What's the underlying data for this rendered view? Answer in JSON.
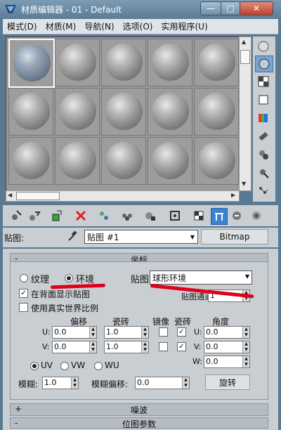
{
  "window": {
    "title": "材质编辑器 - 01 - Default",
    "minimize_icon": "minimize-icon",
    "maximize_icon": "maximize-icon",
    "close_icon": "close-icon"
  },
  "menu": [
    "模式(D)",
    "材质(M)",
    "导航(N)",
    "选项(O)",
    "实用程序(U)"
  ],
  "sample_slots": {
    "count": 15,
    "active_index": 0
  },
  "side_toolbar_icons": [
    "sample-type-icon",
    "backlight-icon",
    "background-icon",
    "uv-tiling-icon",
    "video-color-check-icon",
    "make-preview-icon",
    "options-icon",
    "select-by-material-icon",
    "material-map-navigator-icon"
  ],
  "bottom_toolbar_icons": [
    "get-material-icon",
    "put-to-scene-icon",
    "assign-to-selection-icon",
    "reset-map-icon",
    "make-unique-icon",
    "put-to-library-icon",
    "material-effects-channel-icon",
    "show-in-viewport-icon",
    "show-end-result-icon",
    "go-to-parent-icon",
    "go-forward-to-sibling-icon"
  ],
  "map_row": {
    "label": "贴图:",
    "map_name": "贴图 #1",
    "type_button": "Bitmap"
  },
  "rollouts": {
    "coordinates": {
      "sign": "-",
      "title": "坐标"
    },
    "noise": {
      "sign": "+",
      "title": "噪波"
    },
    "bitmap_params": {
      "sign": "-",
      "title": "位图参数"
    }
  },
  "coords": {
    "texture_label": "纹理",
    "environ_label": "环境",
    "mapping_label": "贴图:",
    "mapping_value": "球形环境",
    "show_map_on_back": "在背面显示贴图",
    "map_channel_label": "贴图通道:",
    "map_channel_value": "1",
    "real_world_scale": "使用真实世界比例",
    "headers": {
      "offset": "偏移",
      "tiling": "瓷砖",
      "mirror": "镜像",
      "tile": "瓷砖",
      "angle": "角度"
    },
    "u": {
      "label": "U:",
      "offset": "0.0",
      "tiling": "1.0",
      "angle_label": "U:",
      "angle": "0.0"
    },
    "v": {
      "label": "V:",
      "offset": "0.0",
      "tiling": "1.0",
      "angle_label": "V:",
      "angle": "0.0"
    },
    "w": {
      "angle_label": "W:",
      "angle": "0.0"
    },
    "uv": "UV",
    "vw": "VW",
    "wu": "WU",
    "blur_label": "模糊:",
    "blur_value": "1.0",
    "blur_offset_label": "模糊偏移:",
    "blur_offset_value": "0.0",
    "rotate_button": "旋转"
  },
  "colors": {
    "title_bar": "#6d8ca6",
    "panel": "#c9ced3",
    "annotation": "#e0001a",
    "active_button": "#3a83d0"
  }
}
